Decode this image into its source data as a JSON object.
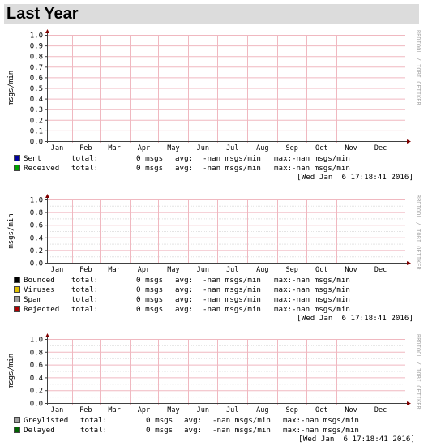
{
  "header": {
    "title": "Last Year"
  },
  "colors": {
    "major_grid": "#f0b8c0",
    "minor_grid": "#e4e4e4",
    "axis": "#404040",
    "arrow": "#800000",
    "title_bar": "#dcdcdc"
  },
  "watermark": "RRDTOOL / TOBI OETIKER",
  "chart_data": [
    {
      "type": "line",
      "ylabel": "msgs/min",
      "ylim": [
        0,
        1.0
      ],
      "yticks": [
        "0.0",
        "0.1",
        "0.2",
        "0.3",
        "0.4",
        "0.5",
        "0.6",
        "0.7",
        "0.8",
        "0.9",
        "1.0"
      ],
      "xlim": [
        "2015-01-06",
        "2016-01-06"
      ],
      "xticks": [
        "Jan",
        "Feb",
        "Mar",
        "Apr",
        "May",
        "Jun",
        "Jul",
        "Aug",
        "Sep",
        "Oct",
        "Nov",
        "Dec"
      ],
      "grid": true,
      "series": [
        {
          "name": "Sent",
          "color": "#0000a0",
          "values": [],
          "total": "0 msgs",
          "avg": "-nan msgs/min",
          "max": "-nan msgs/min"
        },
        {
          "name": "Received",
          "color": "#00a000",
          "values": [],
          "total": "0 msgs",
          "avg": "-nan msgs/min",
          "max": "-nan msgs/min"
        }
      ],
      "timestamp": "[Wed Jan  6 17:18:41 2016]"
    },
    {
      "type": "line",
      "ylabel": "msgs/min",
      "ylim": [
        0,
        1.0
      ],
      "yticks": [
        "0.0",
        "0.2",
        "0.4",
        "0.6",
        "0.8",
        "1.0"
      ],
      "xlim": [
        "2015-01-06",
        "2016-01-06"
      ],
      "xticks": [
        "Jan",
        "Feb",
        "Mar",
        "Apr",
        "May",
        "Jun",
        "Jul",
        "Aug",
        "Sep",
        "Oct",
        "Nov",
        "Dec"
      ],
      "grid": true,
      "series": [
        {
          "name": "Bounced",
          "color": "#000000",
          "values": [],
          "total": "0 msgs",
          "avg": "-nan msgs/min",
          "max": "-nan msgs/min"
        },
        {
          "name": "Viruses",
          "color": "#e0c000",
          "values": [],
          "total": "0 msgs",
          "avg": "-nan msgs/min",
          "max": "-nan msgs/min"
        },
        {
          "name": "Spam",
          "color": "#a0a0a0",
          "values": [],
          "total": "0 msgs",
          "avg": "-nan msgs/min",
          "max": "-nan msgs/min"
        },
        {
          "name": "Rejected",
          "color": "#b00000",
          "values": [],
          "total": "0 msgs",
          "avg": "-nan msgs/min",
          "max": "-nan msgs/min"
        }
      ],
      "timestamp": "[Wed Jan  6 17:18:41 2016]"
    },
    {
      "type": "line",
      "ylabel": "msgs/min",
      "ylim": [
        0,
        1.0
      ],
      "yticks": [
        "0.0",
        "0.2",
        "0.4",
        "0.6",
        "0.8",
        "1.0"
      ],
      "xlim": [
        "2015-01-06",
        "2016-01-06"
      ],
      "xticks": [
        "Jan",
        "Feb",
        "Mar",
        "Apr",
        "May",
        "Jun",
        "Jul",
        "Aug",
        "Sep",
        "Oct",
        "Nov",
        "Dec"
      ],
      "grid": true,
      "series": [
        {
          "name": "Greylisted",
          "color": "#a0a0a0",
          "values": [],
          "total": "0 msgs",
          "avg": "-nan msgs/min",
          "max": "-nan msgs/min"
        },
        {
          "name": "Delayed",
          "color": "#006400",
          "values": [],
          "total": "0 msgs",
          "avg": "-nan msgs/min",
          "max": "-nan msgs/min"
        }
      ],
      "timestamp": "[Wed Jan  6 17:18:41 2016]"
    }
  ],
  "legend_labels": {
    "total": "total:",
    "avg": "avg:",
    "max": "max:"
  }
}
